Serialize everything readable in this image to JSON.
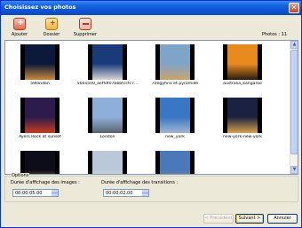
{
  "window": {
    "title": "Choisissez vos photos",
    "close_glyph": "✕"
  },
  "toolbar": {
    "add_label": "Ajouter",
    "folder_label": "Dossier",
    "delete_label": "Supprimer"
  },
  "photo_count": "Photos : 11",
  "photos": [
    {
      "caption": "59london",
      "palette": [
        "#0b1a3a",
        "#c98a3a"
      ],
      "selected": false
    },
    {
      "caption": "500x500_aeffdf07bbbfccfc7...",
      "palette": [
        "#1a3b7a",
        "#d7d7d7"
      ],
      "selected": false
    },
    {
      "caption": "70egyhrix et pyramide",
      "palette": [
        "#7ea4c8",
        "#c9a46a"
      ],
      "selected": false
    },
    {
      "caption": "australia_kangaroo",
      "palette": [
        "#e98a1f",
        "#2a1a10"
      ],
      "selected": false
    },
    {
      "caption": "Ayers Rock at sunset",
      "palette": [
        "#2c1b4d",
        "#c73d1d"
      ],
      "selected": false
    },
    {
      "caption": "London",
      "palette": [
        "#8eb0d8",
        "#5a6470"
      ],
      "selected": false
    },
    {
      "caption": "new_york",
      "palette": [
        "#3976c4",
        "#9fb7d0"
      ],
      "selected": false
    },
    {
      "caption": "new-york-new-york",
      "palette": [
        "#1b2140",
        "#d9a24a"
      ],
      "selected": false
    },
    {
      "caption": "",
      "palette": [
        "#0d0d1a",
        "#e0a030"
      ],
      "selected": false
    },
    {
      "caption": "",
      "palette": [
        "#b9c9d9",
        "#e8ecef"
      ],
      "selected": false
    },
    {
      "caption": "",
      "palette": [
        "#4a78b8",
        "#a89070"
      ],
      "selected": false
    }
  ],
  "options": {
    "legend": "Options",
    "image_duration_label": "Durée d'affichage des images :",
    "image_duration_value": "00:00:05.00",
    "transition_duration_label": "Durée d'affichage des transitions :",
    "transition_duration_value": "00:00:02.00"
  },
  "buttons": {
    "previous": "< Précédent",
    "next": "Suivant >",
    "cancel": "Annuler"
  }
}
